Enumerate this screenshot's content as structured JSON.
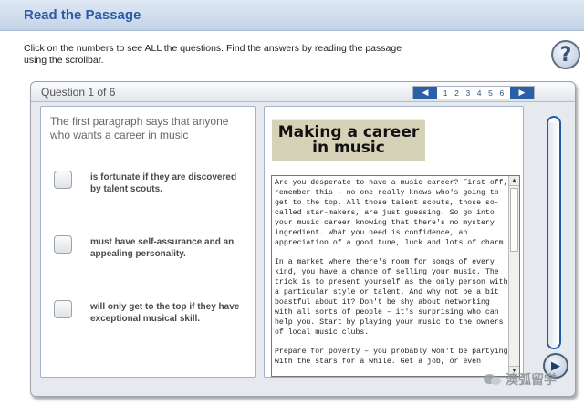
{
  "header": {
    "title": "Read the Passage"
  },
  "instructions": "Click on the numbers to see ALL the questions. Find the answers by reading the passage using the scrollbar.",
  "help_label": "?",
  "question_nav": {
    "counter": "Question 1 of 6",
    "prev_label": "◀",
    "next_label": "▶",
    "numbers": [
      "1",
      "2",
      "3",
      "4",
      "5",
      "6"
    ]
  },
  "question": {
    "prompt": "The first paragraph says that anyone who wants a career in music",
    "options": [
      "is fortunate if they are discovered by talent scouts.",
      "must have self-assurance and an appealing personality.",
      "will only get to the top if they have exceptional musical skill."
    ]
  },
  "passage": {
    "title": "Making a career\nin music",
    "paragraphs": [
      "Are you desperate to have a music career?  First off, remember this – no one really knows who's going to get to the top.  All those talent scouts, those so-called star-makers, are just guessing.  So go into your music career knowing that there's no mystery ingredient.  What you need is confidence, an appreciation of a good tune, luck and lots of charm.",
      "In a market where there's room for songs of every kind, you have a chance of selling your music.  The trick is to present yourself as the only person with a particular style or talent.  And why not be a bit boastful about it?  Don't be shy about networking with all sorts of people – it's surprising who can help you.  Start by playing your music to the owners of local music clubs.",
      "Prepare for poverty – you probably won't be partying with the stars for a while.  Get a job, or even"
    ],
    "scroll_up": "▲",
    "scroll_down": "▼"
  },
  "progress": {
    "fraction": 0.98
  },
  "next_button": "▶",
  "watermark": {
    "text": "澳弧留学"
  },
  "colors": {
    "accent": "#2b5fa8",
    "title": "#2a5aa8",
    "banner": "#d5d2b8"
  }
}
